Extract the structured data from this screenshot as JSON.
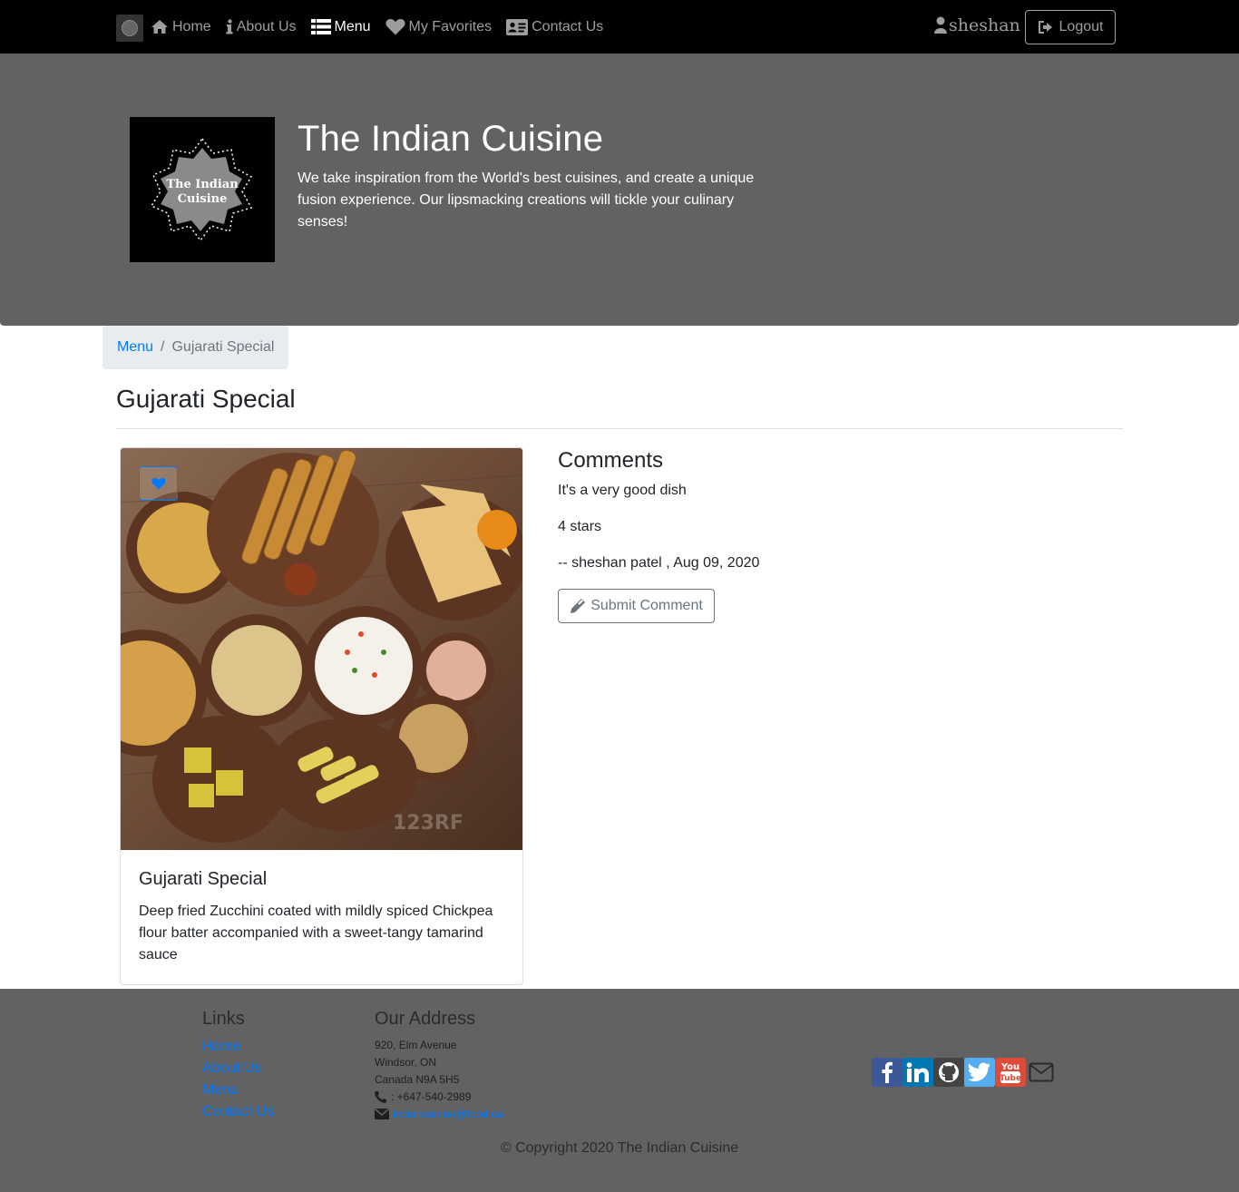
{
  "nav": {
    "items": [
      {
        "label": "Home",
        "icon": "home-icon"
      },
      {
        "label": "About Us",
        "icon": "info-icon"
      },
      {
        "label": "Menu",
        "icon": "list-icon",
        "active": true
      },
      {
        "label": "My Favorites",
        "icon": "heart-icon"
      },
      {
        "label": "Contact Us",
        "icon": "address-card-icon"
      }
    ],
    "username": "sheshan",
    "logout_label": "Logout"
  },
  "jumbotron": {
    "title": "The Indian Cuisine",
    "description": "We take inspiration from the World's best cuisines, and create a unique fusion experience. Our lipsmacking creations will tickle your culinary senses!",
    "logo_text_line1": "The Indian",
    "logo_text_line2": "Cuisine"
  },
  "breadcrumb": {
    "parent": "Menu",
    "current": "Gujarati Special"
  },
  "page": {
    "title": "Gujarati Special"
  },
  "dish": {
    "name": "Gujarati Special",
    "description": "Deep fried Zucchini coated with mildly spiced Chickpea flour batter accompanied with a sweet-tangy tamarind sauce",
    "image_watermark": "123RF"
  },
  "comments": {
    "heading": "Comments",
    "items": [
      {
        "text": "It's a very good dish",
        "rating": "4 stars",
        "author_line": "-- sheshan patel , Aug 09, 2020"
      }
    ],
    "submit_label": "Submit Comment"
  },
  "footer": {
    "links_heading": "Links",
    "links": [
      "Home",
      "About Us",
      "Menu",
      "Contact Us"
    ],
    "address_heading": "Our Address",
    "address_lines": [
      "920, Elm Avenue",
      "Windsor, ON",
      "Canada N9A 5H5"
    ],
    "phone": ": +647-540-2989",
    "email": "indiancuisine@food.ca",
    "copyright": "© Copyright 2020 The Indian Cuisine",
    "social": [
      {
        "name": "facebook",
        "color": "#3b5998"
      },
      {
        "name": "linkedin",
        "color": "#0077b5"
      },
      {
        "name": "github",
        "color": "#444444"
      },
      {
        "name": "twitter",
        "color": "#55acee"
      },
      {
        "name": "youtube",
        "color": "#dd4b39"
      }
    ]
  },
  "colors": {
    "nav_bg": "#000000",
    "jumbotron_bg": "#626262",
    "footer_bg": "#626262",
    "link": "#007bff",
    "breadcrumb_bg": "#e9ecef"
  }
}
